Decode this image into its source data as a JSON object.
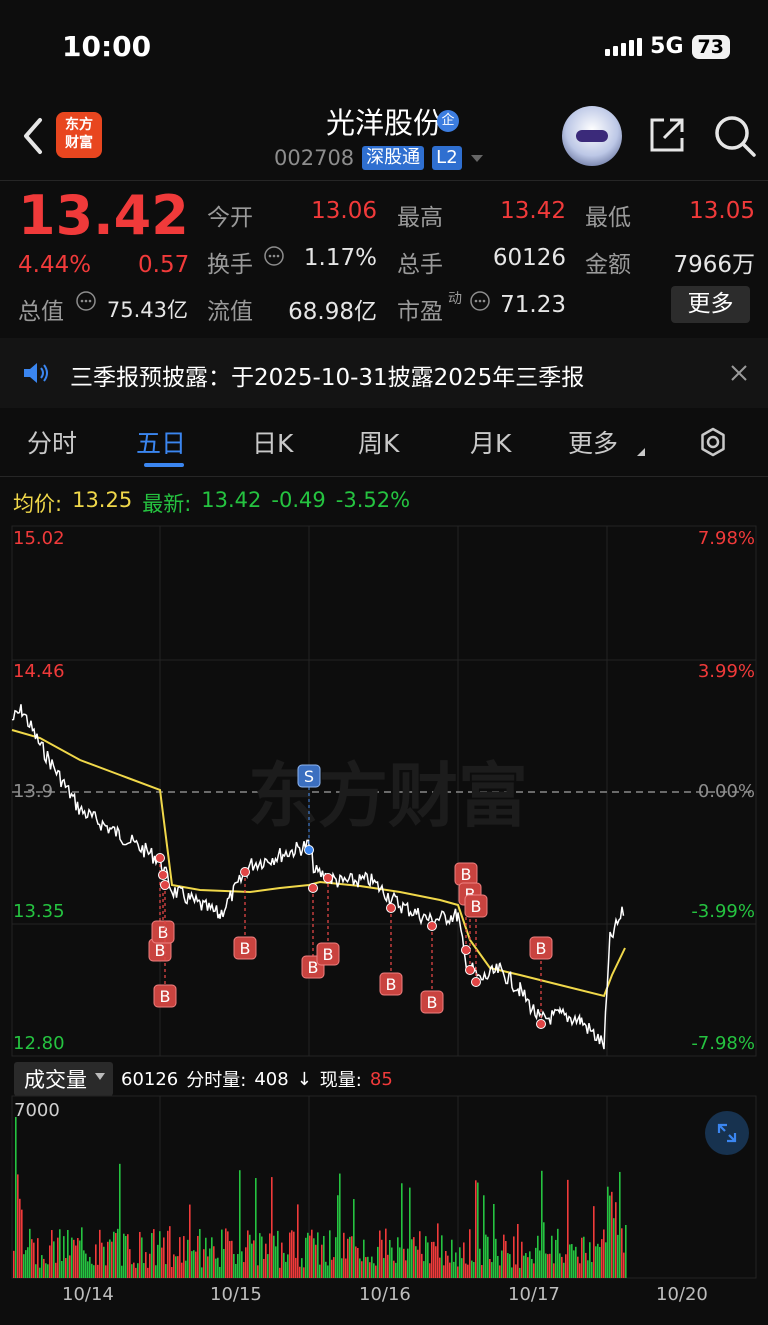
{
  "status_bar": {
    "time": "10:00",
    "network": "5G",
    "battery": "73"
  },
  "header": {
    "logo_line1": "东方",
    "logo_line2": "财富",
    "stock_name": "光洋股份",
    "badge": "企",
    "code": "002708",
    "tag_connect": "深股通",
    "tag_level": "L2"
  },
  "quote": {
    "price": "13.42",
    "change_pct": "4.44%",
    "change_abs": "0.57",
    "open_label": "今开",
    "open": "13.06",
    "high_label": "最高",
    "high": "13.42",
    "low_label": "最低",
    "low": "13.05",
    "turnover_label": "换手",
    "turnover": "1.17%",
    "volume_label": "总手",
    "volume": "60126",
    "amount_label": "金额",
    "amount": "7966万",
    "mktcap_label": "总值",
    "mktcap": "75.43亿",
    "float_label": "流值",
    "float_cap": "68.98亿",
    "pe_label": "市盈",
    "pe_sup": "动",
    "pe": "71.23",
    "more_label": "更多"
  },
  "notice": {
    "text": "三季报预披露：于2025-10-31披露2025年三季报"
  },
  "tabs": [
    "分时",
    "五日",
    "日K",
    "周K",
    "月K",
    "更多"
  ],
  "active_tab": "五日",
  "legend": {
    "avg_label": "均价:",
    "avg": "13.25",
    "latest_label": "最新:",
    "latest": "13.42",
    "chg": "-0.49",
    "chg_pct": "-3.52%"
  },
  "chart": {
    "y_left": [
      "15.02",
      "14.46",
      "13.9",
      "13.35",
      "12.80"
    ],
    "y_right": [
      "7.98%",
      "3.99%",
      "0.00%",
      "-3.99%",
      "-7.98%"
    ],
    "watermark": "东方财富",
    "marker_buy": "B",
    "marker_sell": "S"
  },
  "volume": {
    "selector": "成交量",
    "total": "60126",
    "fenshi_label": "分时量:",
    "fenshi": "408",
    "arrow": "↓",
    "now_label": "现量:",
    "now": "85",
    "max_label": "7000"
  },
  "dates": [
    "10/14",
    "10/15",
    "10/16",
    "10/17",
    "10/20"
  ],
  "colors": {
    "up": "#f03a3a",
    "down": "#25c340",
    "avg_line": "#f0d84a",
    "accent": "#3b86f0"
  }
}
